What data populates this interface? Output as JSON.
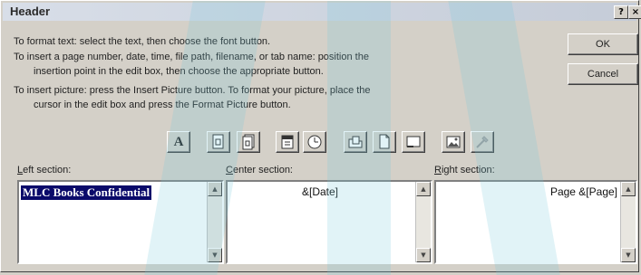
{
  "window": {
    "title": "Header"
  },
  "titlebar": {
    "help_glyph": "?",
    "close_glyph": "×"
  },
  "instructions": {
    "line1": "To format text:  select the text, then choose the font button.",
    "line2": "To insert a page number, date, time, file path, filename, or tab name:  position the",
    "line3": "insertion point in the edit box, then choose the appropriate button.",
    "line4": "To insert picture: press the Insert Picture button.  To format your picture, place the",
    "line5": "cursor in the edit box and press the Format Picture button."
  },
  "buttons": {
    "ok": "OK",
    "cancel": "Cancel"
  },
  "toolbar": {
    "icons": [
      "font-icon",
      "page-number-icon",
      "total-pages-icon",
      "date-icon",
      "time-icon",
      "file-path-icon",
      "filename-icon",
      "sheet-name-icon",
      "insert-picture-icon",
      "format-picture-icon"
    ],
    "font_glyph": "A"
  },
  "sections": {
    "left": {
      "label_prefix": "",
      "label_underlined": "L",
      "label_rest": "eft section:",
      "content": "MLC Books Confidential"
    },
    "center": {
      "label_prefix": "",
      "label_underlined": "C",
      "label_rest": "enter section:",
      "content": "&[Date]"
    },
    "right": {
      "label_prefix": "",
      "label_underlined": "R",
      "label_rest": "ight section:",
      "content": "Page &[Page]"
    }
  },
  "scrollbar": {
    "up_glyph": "▲",
    "down_glyph": "▼"
  },
  "colors": {
    "dialog_bg": "#d4d0c8",
    "selection": "#0a0a6a",
    "watermark": "#78c8dc"
  }
}
